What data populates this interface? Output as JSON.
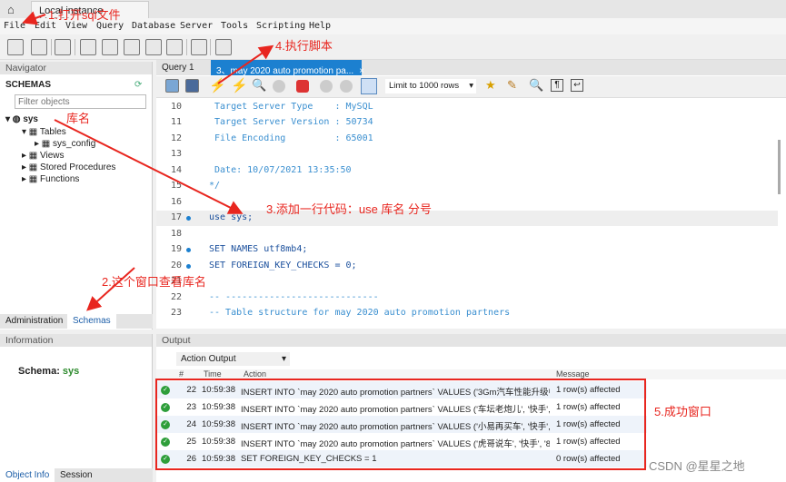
{
  "window": {
    "home_icon": "home-icon",
    "connection_tab": "Local instance MySQL"
  },
  "menu": [
    "File",
    "Edit",
    "View",
    "Query",
    "Database",
    "Server",
    "Tools",
    "Scripting",
    "Help"
  ],
  "navigator": {
    "header": "Navigator",
    "schemas_label": "SCHEMAS",
    "filter_placeholder": "Filter objects",
    "tree": {
      "schema": "sys",
      "tables": "Tables",
      "table1": "sys_config",
      "views": "Views",
      "procs": "Stored Procedures",
      "funcs": "Functions"
    },
    "tabs": [
      "Administration",
      "Schemas"
    ],
    "active_tab": "Schemas"
  },
  "information": {
    "header": "Information",
    "schema_label": "Schema:",
    "schema_value": "sys",
    "tabs": [
      "Object Info",
      "Session"
    ]
  },
  "editor": {
    "tabs": [
      "Query 1",
      "3、may 2020 auto promotion pa..."
    ],
    "active_tab": 1,
    "limit_select": "Limit to 1000 rows",
    "lines": [
      {
        "n": "10",
        "text": " Target Server Type    : MySQL",
        "type": "comment"
      },
      {
        "n": "11",
        "text": " Target Server Version : 50734",
        "type": "comment"
      },
      {
        "n": "12",
        "text": " File Encoding         : 65001",
        "type": "comment"
      },
      {
        "n": "13",
        "text": "",
        "type": "comment"
      },
      {
        "n": "14",
        "text": " Date: 10/07/2021 13:35:50",
        "type": "comment"
      },
      {
        "n": "15",
        "text": "*/",
        "type": "comment"
      },
      {
        "n": "16",
        "text": "",
        "type": "plain"
      },
      {
        "n": "17",
        "text": "use sys;",
        "type": "stmt",
        "dot": true
      },
      {
        "n": "18",
        "text": "",
        "type": "plain"
      },
      {
        "n": "19",
        "text": "SET NAMES utf8mb4;",
        "type": "stmt",
        "dot": true
      },
      {
        "n": "20",
        "text": "SET FOREIGN_KEY_CHECKS = 0;",
        "type": "stmt",
        "dot": true
      },
      {
        "n": "21",
        "text": "",
        "type": "plain"
      },
      {
        "n": "22",
        "text": "-- ----------------------------",
        "type": "comment"
      },
      {
        "n": "23",
        "text": "-- Table structure for may 2020 auto promotion partners",
        "type": "comment"
      }
    ]
  },
  "output": {
    "header": "Output",
    "select": "Action Output",
    "columns": [
      "#",
      "Time",
      "Action",
      "Message"
    ],
    "rows": [
      {
        "n": "22",
        "time": "10:59:38",
        "action": "INSERT INTO `may 2020 auto promotion partners` VALUES ('3Gm汽车性能升级中...",
        "msg": "1 row(s) affected"
      },
      {
        "n": "23",
        "time": "10:59:38",
        "action": "INSERT INTO `may 2020 auto promotion partners` VALUES ('车坛老炮儿', '快手', '...",
        "msg": "1 row(s) affected"
      },
      {
        "n": "24",
        "time": "10:59:38",
        "action": "INSERT INTO `may 2020 auto promotion partners` VALUES ('小易再买车', '快手', '...",
        "msg": "1 row(s) affected"
      },
      {
        "n": "25",
        "time": "10:59:38",
        "action": "INSERT INTO `may 2020 auto promotion partners` VALUES ('虎哥说车', '快手', '89....",
        "msg": "1 row(s) affected"
      },
      {
        "n": "26",
        "time": "10:59:38",
        "action": "SET FOREIGN_KEY_CHECKS = 1",
        "msg": "0 row(s) affected"
      }
    ]
  },
  "annotations": {
    "a1": "1.打开sql文件",
    "a2": "2.这个窗口查看库名",
    "a3": "3.添加一行代码：use 库名 分号",
    "a4": "4.执行脚本",
    "a5": "5.成功窗口",
    "dbname": "库名"
  },
  "watermark": "CSDN @星星之地",
  "colors": {
    "accent_tab": "#1c80d0",
    "annotation": "#e8261f",
    "success": "#2e9e3a"
  }
}
